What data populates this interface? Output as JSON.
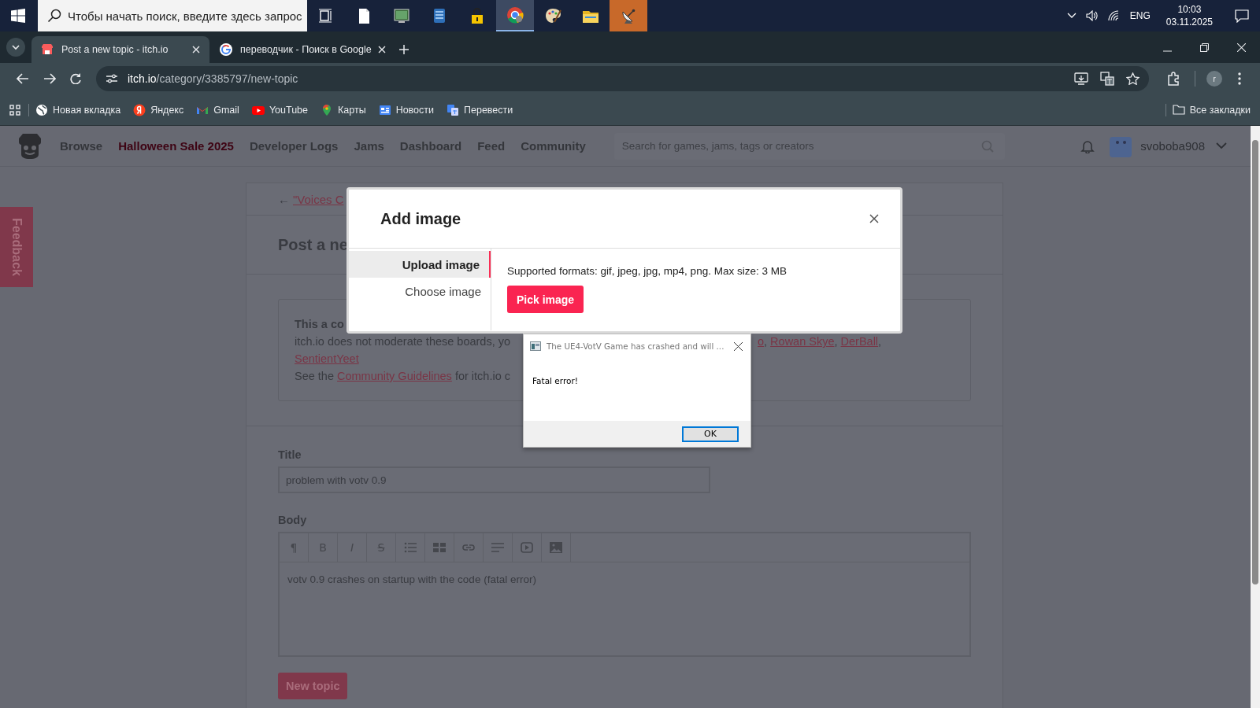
{
  "taskbar": {
    "search_placeholder": "Чтобы начать поиск, введите здесь запрос",
    "apps": [
      {
        "kind": "taskview",
        "selected": false,
        "attention": false
      },
      {
        "kind": "document",
        "selected": false,
        "attention": false
      },
      {
        "kind": "monitor",
        "selected": false,
        "attention": false
      },
      {
        "kind": "database",
        "selected": false,
        "attention": false
      },
      {
        "kind": "padlock",
        "selected": false,
        "attention": false
      },
      {
        "kind": "browser",
        "selected": true,
        "attention": false
      },
      {
        "kind": "palette",
        "selected": false,
        "attention": false
      },
      {
        "kind": "folder",
        "selected": false,
        "attention": false
      },
      {
        "kind": "satellite",
        "selected": false,
        "attention": true
      }
    ],
    "language": "ENG",
    "time": "10:03",
    "date": "03.11.2025"
  },
  "browser": {
    "tabs": [
      {
        "title": "Post a new topic - itch.io",
        "kind": "shop",
        "selected": true
      },
      {
        "title": "переводчик - Поиск в Google",
        "kind": "search",
        "selected": false
      }
    ],
    "address": {
      "host": "itch.io",
      "path": "/category/3385797/new-topic"
    },
    "profile_initial": "r",
    "bookmarks": [
      {
        "label": "Новая вкладка",
        "kind": "globe"
      },
      {
        "label": "Яндекс",
        "kind": "letter"
      },
      {
        "label": "Gmail",
        "kind": "mail"
      },
      {
        "label": "YouTube",
        "kind": "video"
      },
      {
        "label": "Карты",
        "kind": "map"
      },
      {
        "label": "Новости",
        "kind": "news"
      },
      {
        "label": "Перевести",
        "kind": "translate"
      }
    ],
    "all_bookmarks": "Все закладки"
  },
  "site": {
    "nav": [
      {
        "label": "Browse",
        "kind": "normal"
      },
      {
        "label": "Halloween Sale 2025",
        "kind": "sale"
      },
      {
        "label": "Developer Logs",
        "kind": "normal"
      },
      {
        "label": "Jams",
        "kind": "normal"
      },
      {
        "label": "Dashboard",
        "kind": "normal"
      },
      {
        "label": "Feed",
        "kind": "normal"
      },
      {
        "label": "Community",
        "kind": "normal"
      }
    ],
    "search_placeholder": "Search for games, jams, tags or creators",
    "username": "svoboba908"
  },
  "feedback": "Feedback",
  "page": {
    "back_arrow": "←",
    "back_link": "\"Voices C",
    "heading": "Post a ne",
    "notice": {
      "heading": "This a co",
      "line_start": "itch.io does not moderate these boards, yo",
      "moderators": [
        {
          "name": "o",
          "sep": ","
        },
        {
          "name": "Rowan Skye",
          "sep": ","
        },
        {
          "name": "DerBall",
          "sep": ","
        }
      ],
      "last_moderator": "SentientYeet",
      "guidelines_prefix": "See the",
      "guidelines_link": "Community Guidelines",
      "guidelines_suffix": "for itch.io c"
    },
    "form": {
      "title_label": "Title",
      "title_value": "problem with votv 0.9",
      "body_label": "Body",
      "toolbar": [
        {
          "kind": "glyph",
          "text": "¶"
        },
        {
          "kind": "bold",
          "text": "B"
        },
        {
          "kind": "italic",
          "text": "I"
        },
        {
          "kind": "strike",
          "text": "S"
        },
        {
          "kind": "list"
        },
        {
          "kind": "table"
        },
        {
          "kind": "link"
        },
        {
          "kind": "align"
        },
        {
          "kind": "video"
        },
        {
          "kind": "image"
        }
      ],
      "body_value": "votv 0.9 crashes on startup with the code (fatal error)",
      "submit": "New topic"
    }
  },
  "modal": {
    "title": "Add image",
    "tabs": [
      {
        "label": "Upload image",
        "selected": true
      },
      {
        "label": "Choose image",
        "selected": false
      }
    ],
    "formats": "Supported formats: gif, jpeg, jpg, mp4, png. Max size: 3 MB",
    "pick_button": "Pick image"
  },
  "crash": {
    "title": "The UE4-VotV Game has crashed and will ...",
    "message": "Fatal error!",
    "ok": "OK"
  }
}
